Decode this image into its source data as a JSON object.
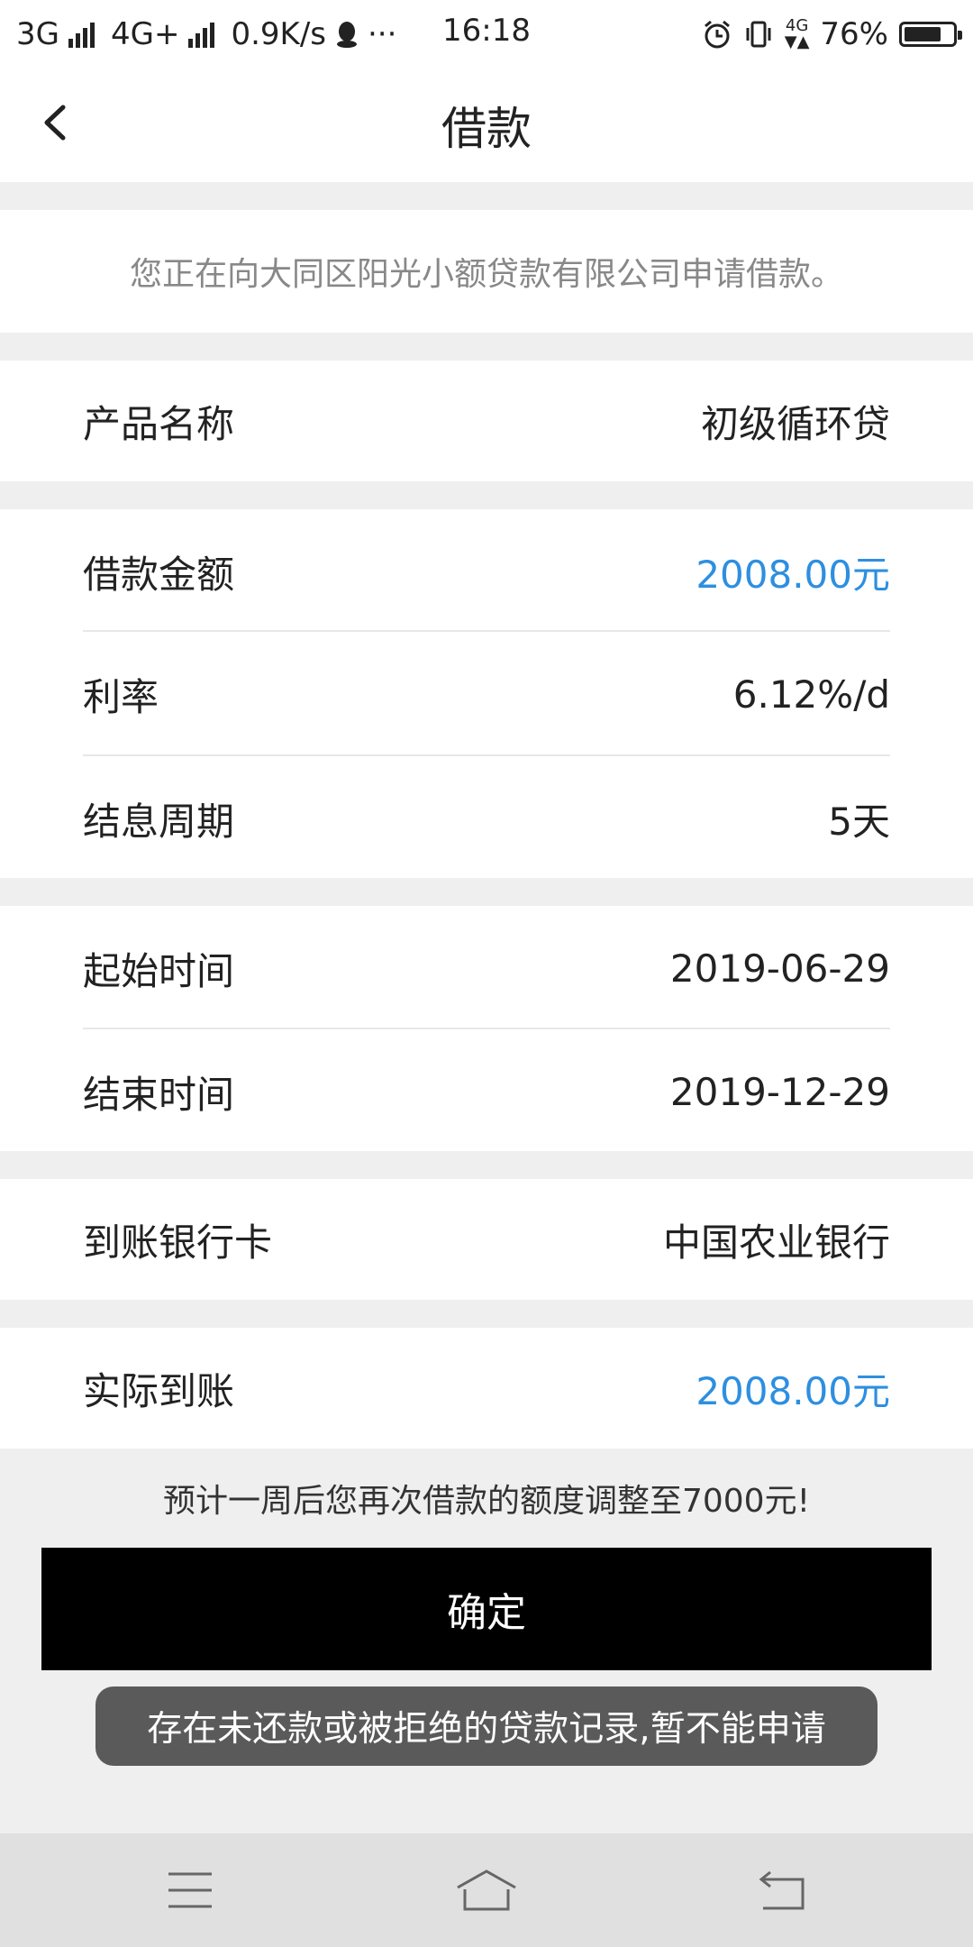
{
  "status_bar": {
    "network1": "3G",
    "network2": "4G+",
    "speed": "0.9K/s",
    "more": "···",
    "time": "16:18",
    "network3": "4G",
    "battery_text": "76%",
    "battery_level": 0.76
  },
  "nav": {
    "title": "借款"
  },
  "notice": "您正在向大同区阳光小额贷款有限公司申请借款。",
  "fields": {
    "product_name": {
      "label": "产品名称",
      "value": "初级循环贷"
    },
    "loan_amount": {
      "label": "借款金额",
      "value": "2008.00元"
    },
    "interest_rate": {
      "label": "利率",
      "value": "6.12%/d"
    },
    "interest_period": {
      "label": "结息周期",
      "value": "5天"
    },
    "start_time": {
      "label": "起始时间",
      "value": "2019-06-29"
    },
    "end_time": {
      "label": "结束时间",
      "value": "2019-12-29"
    },
    "bank_card": {
      "label": "到账银行卡",
      "value": "中国农业银行"
    },
    "actual_received": {
      "label": "实际到账",
      "value": "2008.00元"
    }
  },
  "hint": "预计一周后您再次借款的额度调整至7000元!",
  "confirm_label": "确定",
  "toast": "存在未还款或被拒绝的贷款记录,暂不能申请",
  "colors": {
    "accent_blue": "#2d8fe0",
    "button_bg": "#000000",
    "page_bg": "#efefef"
  }
}
